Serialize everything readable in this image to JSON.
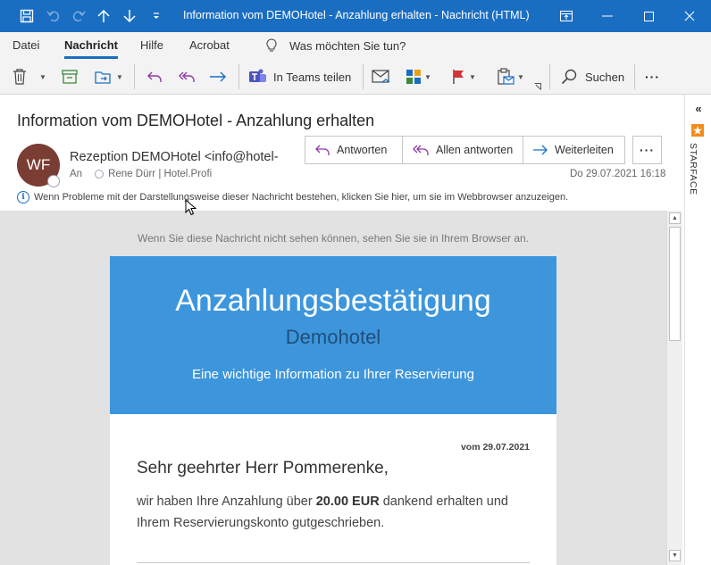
{
  "window": {
    "title": "Information vom DEMOHotel - Anzahlung erhalten  -  Nachricht (HTML)"
  },
  "menu": {
    "tabs": [
      "Datei",
      "Nachricht",
      "Hilfe",
      "Acrobat"
    ],
    "active_tab": "Nachricht",
    "tell_me": "Was möchten Sie tun?"
  },
  "toolbar": {
    "teams_label": "In Teams teilen",
    "search_label": "Suchen",
    "more_label": "···"
  },
  "side_panel": {
    "collapse": "«",
    "label": "STARFACE"
  },
  "message": {
    "subject": "Information vom DEMOHotel - Anzahlung erhalten",
    "avatar_initials": "WF",
    "sender": "Rezeption DEMOHotel <info@hotel-",
    "to_label": "An",
    "recipient": "Rene Dürr | Hotel.Profi",
    "date": "Do 29.07.2021 16:18",
    "reply": "Antworten",
    "reply_all": "Allen antworten",
    "forward": "Weiterleiten",
    "more": "···",
    "infobar": "Wenn Probleme mit der Darstellungsweise dieser Nachricht bestehen, klicken Sie hier, um sie im Webbrowser anzuzeigen."
  },
  "email": {
    "browser_note": "Wenn Sie diese Nachricht nicht sehen können, sehen Sie sie in Ihrem Browser an.",
    "header_title": "Anzahlungsbestätigung",
    "header_subtitle": "Demohotel",
    "header_info": "Eine wichtige Information zu Ihrer Reservierung",
    "header_color": "#3d96dc",
    "date_line": "vom 29.07.2021",
    "salutation": "Sehr geehrter Herr Pommerenke,",
    "para_pre": "wir haben Ihre Anzahlung über ",
    "amount": "20.00 EUR",
    "para_post": " dankend erhalten und Ihrem Reservierungskonto gutgeschrieben."
  }
}
